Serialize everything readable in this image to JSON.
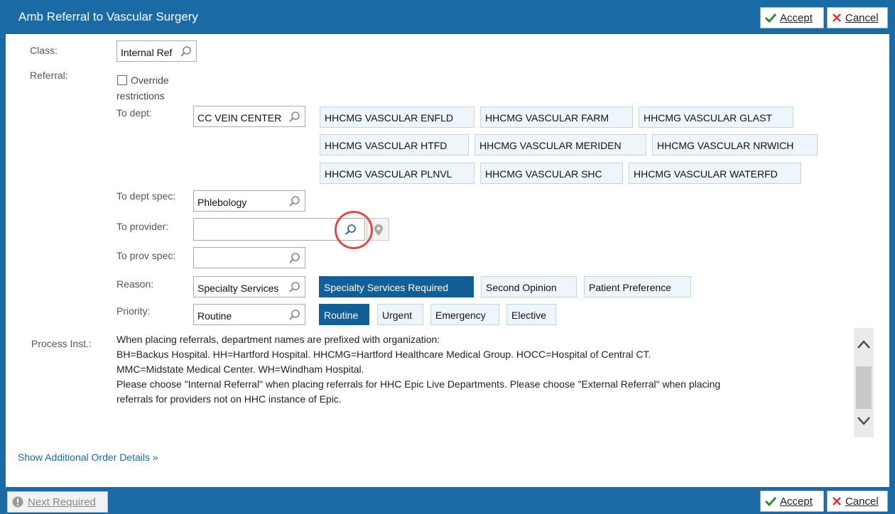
{
  "window": {
    "title": "Amb Referral to Vascular Surgery",
    "accept_label": "Accept",
    "cancel_label": "Cancel",
    "next_required_label": "Next Required"
  },
  "colors": {
    "title_bar": "#1a6aa6",
    "selected_chip": "#125e96",
    "chip_bg": "#eef6fc",
    "highlight_circle": "#e04848"
  },
  "form": {
    "class_label": "Class:",
    "class_value": "Internal Ref",
    "referral_label": "Referral:",
    "override_label_1": "Override",
    "override_label_2": "restrictions",
    "to_dept_label": "To dept:",
    "to_dept_value": "CC VEIN CENTER",
    "dept_options": [
      "HHCMG VASCULAR ENFLD",
      "HHCMG VASCULAR FARM",
      "HHCMG VASCULAR GLAST",
      "HHCMG VASCULAR HTFD",
      "HHCMG VASCULAR MERIDEN",
      "HHCMG VASCULAR NRWICH",
      "HHCMG VASCULAR PLNVL",
      "HHCMG VASCULAR SHC",
      "HHCMG VASCULAR WATERFD"
    ],
    "to_dept_spec_label": "To dept spec:",
    "to_dept_spec_value": "Phlebology",
    "to_provider_label": "To provider:",
    "to_provider_value": "",
    "to_prov_spec_label": "To prov spec:",
    "to_prov_spec_value": "",
    "reason_label": "Reason:",
    "reason_value": "Specialty Services",
    "reason_options": [
      "Specialty Services Required",
      "Second Opinion",
      "Patient Preference"
    ],
    "priority_label": "Priority:",
    "priority_value": "Routine",
    "priority_options": [
      "Routine",
      "Urgent",
      "Emergency",
      "Elective"
    ],
    "process_label": "Process Inst.:",
    "process_lines": [
      "When placing referrals, department names are prefixed with organization:",
      "BH=Backus Hospital.  HH=Hartford Hospital.  HHCMG=Hartford Healthcare Medical Group.  HOCC=Hospital of Central CT.",
      "MMC=Midstate Medical Center.  WH=Windham Hospital.",
      "Please choose \"Internal Referral\" when placing referrals for HHC Epic Live Departments.  Please choose \"External Referral\" when placing",
      "referrals for providers not on HHC instance of Epic."
    ],
    "show_additional_label": "Show Additional Order Details »"
  }
}
